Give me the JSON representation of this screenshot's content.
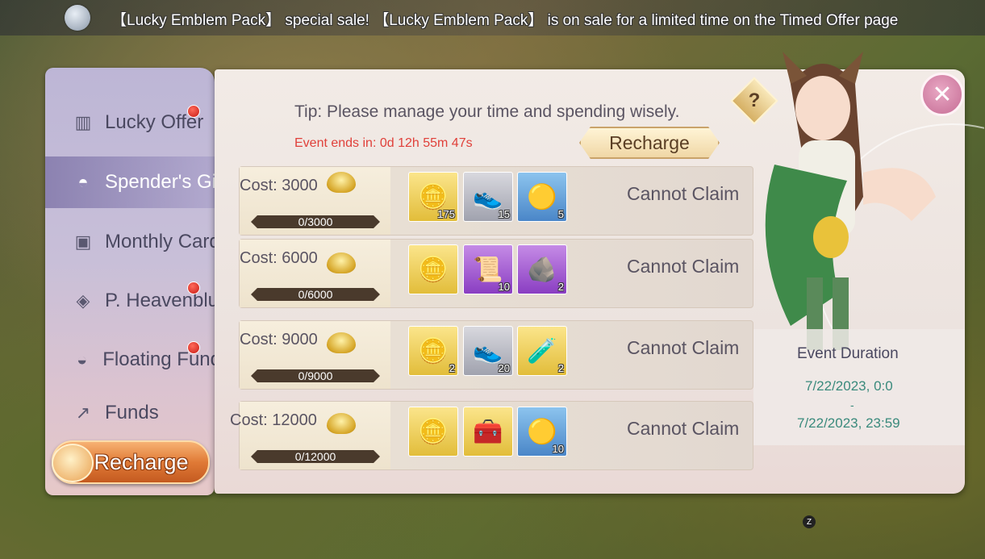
{
  "ticker": {
    "message": "【Lucky Emblem Pack】 special sale! 【Lucky Emblem Pack】 is on sale for a limited time on the Timed Offer page"
  },
  "sidebar": {
    "items": [
      {
        "label": "Lucky Offer",
        "icon": "ticket-icon",
        "badge": true,
        "active": false
      },
      {
        "label": "Spender's Gift",
        "icon": "ingot-icon",
        "badge": false,
        "active": true
      },
      {
        "label": "Monthly Card",
        "icon": "card-icon",
        "badge": false,
        "active": false
      },
      {
        "label": "P. Heavenblue",
        "icon": "diamond-icon",
        "badge": true,
        "active": false
      },
      {
        "label": "Floating Funds",
        "icon": "bowl-icon",
        "badge": true,
        "active": false
      },
      {
        "label": "Funds",
        "icon": "chart-icon",
        "badge": false,
        "active": false
      }
    ],
    "recharge_label": "Recharge"
  },
  "header": {
    "tip": "Tip: Please manage your time and spending wisely.",
    "countdown": "Event ends in: 0d 12h 55m 47s",
    "recharge_label": "Recharge",
    "help_label": "?"
  },
  "tiers": [
    {
      "cost": "Cost: 3000",
      "progress": "0/3000",
      "progress_fraction": 0,
      "status": "Cannot Claim",
      "rewards": [
        {
          "icon": "ingot-icon",
          "rarity": "gold",
          "qty": "175"
        },
        {
          "icon": "shoe-icon",
          "rarity": "silver",
          "qty": "15"
        },
        {
          "icon": "coin-icon",
          "rarity": "blue",
          "qty": "5"
        }
      ]
    },
    {
      "cost": "Cost: 6000",
      "progress": "0/6000",
      "progress_fraction": 0,
      "status": "Cannot Claim",
      "rewards": [
        {
          "icon": "ingot-icon",
          "rarity": "gold",
          "qty": ""
        },
        {
          "icon": "scroll-icon",
          "rarity": "purple",
          "qty": "10"
        },
        {
          "icon": "ore-icon",
          "rarity": "purple",
          "qty": "2"
        }
      ]
    },
    {
      "cost": "Cost: 9000",
      "progress": "0/9000",
      "progress_fraction": 0,
      "status": "Cannot Claim",
      "rewards": [
        {
          "icon": "ingot-icon",
          "rarity": "gold",
          "qty": "2"
        },
        {
          "icon": "shoe-icon",
          "rarity": "silver",
          "qty": "20"
        },
        {
          "icon": "potion-icon",
          "rarity": "gold",
          "qty": "2"
        }
      ]
    },
    {
      "cost": "Cost: 12000",
      "progress": "0/12000",
      "progress_fraction": 0,
      "status": "Cannot Claim",
      "rewards": [
        {
          "icon": "ingot-icon",
          "rarity": "gold",
          "qty": ""
        },
        {
          "icon": "chest-icon",
          "rarity": "gold",
          "qty": ""
        },
        {
          "icon": "coin-icon",
          "rarity": "blue",
          "qty": "10"
        }
      ]
    }
  ],
  "duration": {
    "title": "Event Duration",
    "start": "7/22/2023, 0:0",
    "separator": "-",
    "end": "7/22/2023, 23:59"
  },
  "overlay_key": "Z",
  "colors": {
    "countdown_red": "#e0403a",
    "duration_teal": "#3a8a7c",
    "progress_bar": "#4a3a2c",
    "active_tab": "#8278aa"
  }
}
